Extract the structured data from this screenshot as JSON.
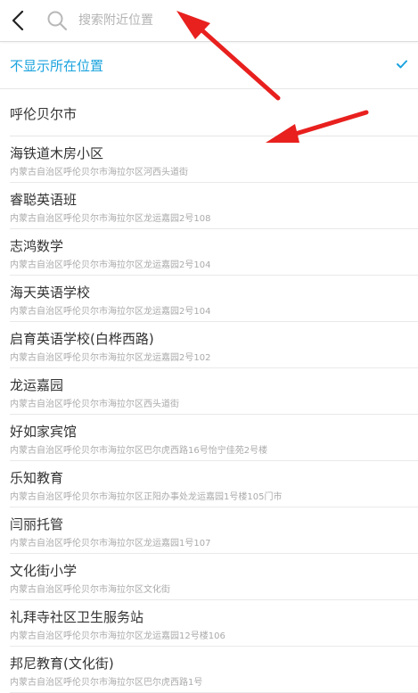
{
  "header": {
    "back_icon": "back-chevron-icon",
    "search_icon": "search-icon",
    "search_placeholder": "搜索附近位置",
    "search_value": ""
  },
  "selected_option": {
    "label": "不显示所在位置",
    "check_icon": "checkmark-icon",
    "color": "#1aa3de"
  },
  "city": {
    "label": "呼伦贝尔市"
  },
  "pois": [
    {
      "name": "海铁道木房小区",
      "address": "内蒙古自治区呼伦贝尔市海拉尔区河西头道街"
    },
    {
      "name": "睿聪英语班",
      "address": "内蒙古自治区呼伦贝尔市海拉尔区龙运嘉园2号108"
    },
    {
      "name": "志鸿数学",
      "address": "内蒙古自治区呼伦贝尔市海拉尔区龙运嘉园2号104"
    },
    {
      "name": "海天英语学校",
      "address": "内蒙古自治区呼伦贝尔市海拉尔区龙运嘉园2号104"
    },
    {
      "name": "启育英语学校(白桦西路)",
      "address": "内蒙古自治区呼伦贝尔市海拉尔区龙运嘉园2号102"
    },
    {
      "name": "龙运嘉园",
      "address": "内蒙古自治区呼伦贝尔市海拉尔区西头道街"
    },
    {
      "name": "好如家宾馆",
      "address": "内蒙古自治区呼伦贝尔市海拉尔区巴尔虎西路16号怡宁佳苑2号楼"
    },
    {
      "name": "乐知教育",
      "address": "内蒙古自治区呼伦贝尔市海拉尔区正阳办事处龙运嘉园1号楼105门市"
    },
    {
      "name": "闫丽托管",
      "address": "内蒙古自治区呼伦贝尔市海拉尔区龙运嘉园1号107"
    },
    {
      "name": "文化街小学",
      "address": "内蒙古自治区呼伦贝尔市海拉尔区文化街"
    },
    {
      "name": "礼拜寺社区卫生服务站",
      "address": "内蒙古自治区呼伦贝尔市海拉尔区龙运嘉园12号楼106"
    },
    {
      "name": "邦尼教育(文化街)",
      "address": "内蒙古自治区呼伦贝尔市海拉尔区巴尔虎西路1号"
    }
  ],
  "annotations": {
    "arrow_color": "#e8201e"
  }
}
